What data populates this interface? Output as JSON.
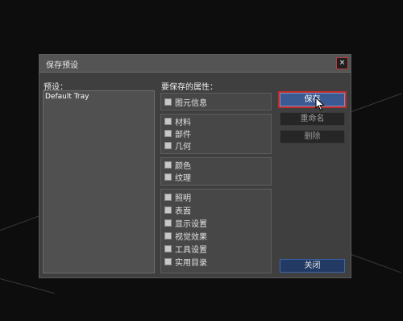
{
  "dialog": {
    "title": "保存预设",
    "close_glyph": "×"
  },
  "presets": {
    "label": "预设：",
    "items": [
      "Default Tray"
    ]
  },
  "attributes": {
    "label": "要保存的属性：",
    "groups": [
      [
        "图元信息"
      ],
      [
        "材料",
        "部件",
        "几何"
      ],
      [
        "颜色",
        "纹理"
      ],
      [
        "照明",
        "表面",
        "显示设置",
        "视觉效果",
        "工具设置",
        "实用目录"
      ]
    ]
  },
  "buttons": {
    "save": "保存",
    "rename": "重命名",
    "delete": "删除",
    "cancel": "关闭"
  }
}
